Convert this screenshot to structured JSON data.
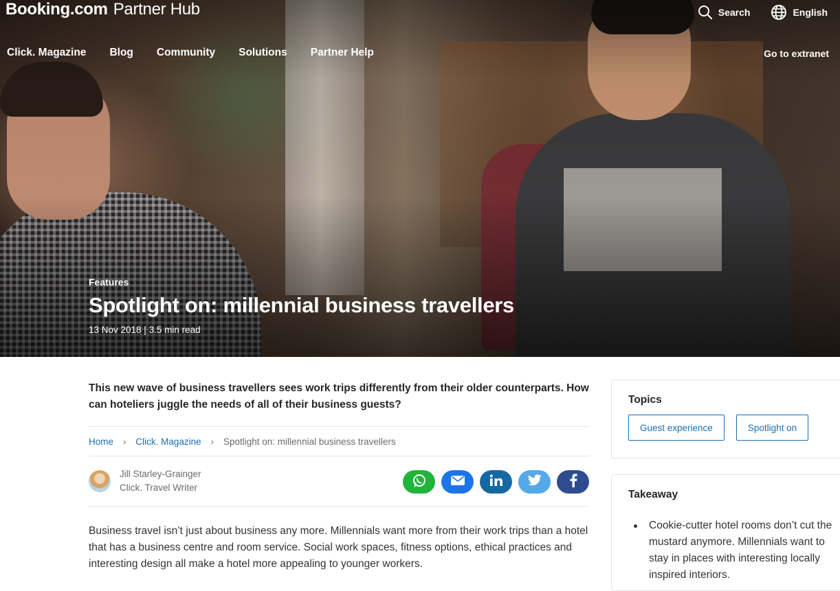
{
  "header": {
    "brand": "Booking.com",
    "product": "Partner Hub",
    "search_label": "Search",
    "language_label": "English",
    "nav": [
      "Click. Magazine",
      "Blog",
      "Community",
      "Solutions",
      "Partner Help"
    ],
    "extranet_label": "Go to extranet"
  },
  "hero": {
    "category": "Features",
    "title": "Spotlight on: millennial business travellers",
    "meta": "13 Nov 2018 | 3.5 min read"
  },
  "article": {
    "intro": "This new wave of business travellers sees work trips differently from their older counterparts. How can hoteliers juggle the needs of all of their business guests?",
    "breadcrumb": [
      "Home",
      "Click. Magazine",
      "Spotlight on: millennial business travellers"
    ],
    "author": {
      "name": "Jill Starley-Grainger",
      "role": "Click. Travel Writer"
    },
    "share_icons": [
      "whatsapp-icon",
      "email-icon",
      "linkedin-icon",
      "twitter-icon",
      "facebook-icon"
    ],
    "body": "Business travel isn’t just about business any more. Millennials want more from their work trips than a hotel that has a business centre and room service. Social work spaces, fitness options, ethical practices and interesting design all make a hotel more appealing to younger workers."
  },
  "sidebar": {
    "topics_title": "Topics",
    "topics": [
      "Guest experience",
      "Spotlight on"
    ],
    "takeaway_title": "Takeaway",
    "takeaways": [
      "Cookie-cutter hotel rooms don’t cut the mustard anymore. Millennials want to stay in places with interesting locally inspired interiors."
    ]
  },
  "colors": {
    "link": "#1a6fb5",
    "whatsapp": "#1fb43a",
    "email": "#1b75e8",
    "linkedin": "#1668a3",
    "twitter": "#55a9e8",
    "facebook": "#2e4c8f"
  }
}
